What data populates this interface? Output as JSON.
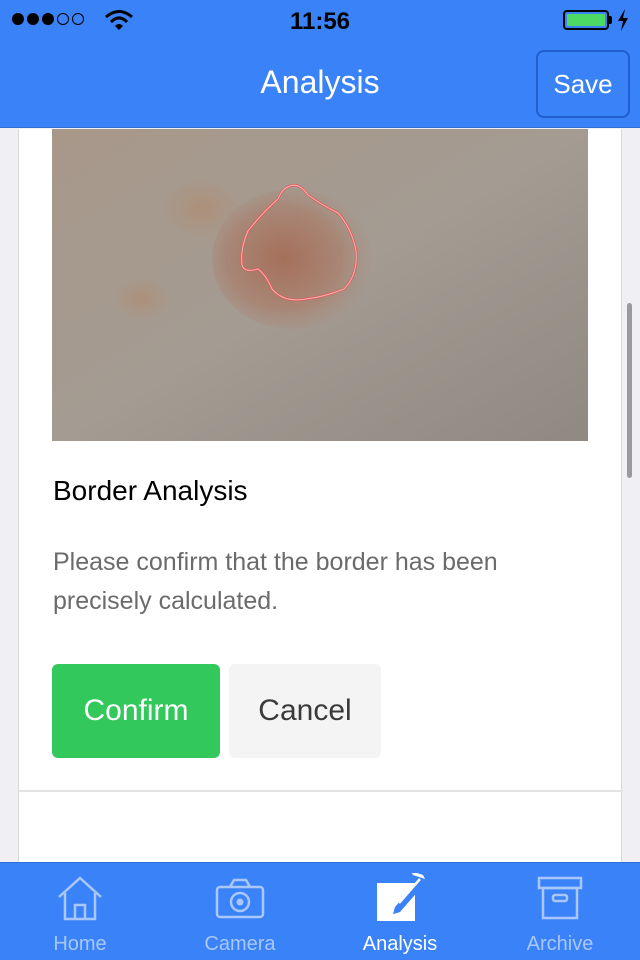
{
  "status_bar": {
    "time": "11:56",
    "signal_bars_filled": 3,
    "signal_bars_total": 5,
    "battery_level": 1.0,
    "charging": true
  },
  "nav": {
    "title": "Analysis",
    "save_label": "Save"
  },
  "analysis": {
    "section_title": "Border Analysis",
    "description": "Please confirm that the border has been precisely calculated.",
    "confirm_label": "Confirm",
    "cancel_label": "Cancel"
  },
  "tabs": [
    {
      "label": "Home",
      "icon": "house-icon",
      "active": false
    },
    {
      "label": "Camera",
      "icon": "camera-icon",
      "active": false
    },
    {
      "label": "Analysis",
      "icon": "edit-icon",
      "active": true
    },
    {
      "label": "Archive",
      "icon": "archive-box-icon",
      "active": false
    }
  ],
  "colors": {
    "bar_blue": "#3a82f7",
    "confirm_green": "#33c85b",
    "border_outline": "#e05a5a",
    "inactive_tab": "#a9c7fb"
  }
}
